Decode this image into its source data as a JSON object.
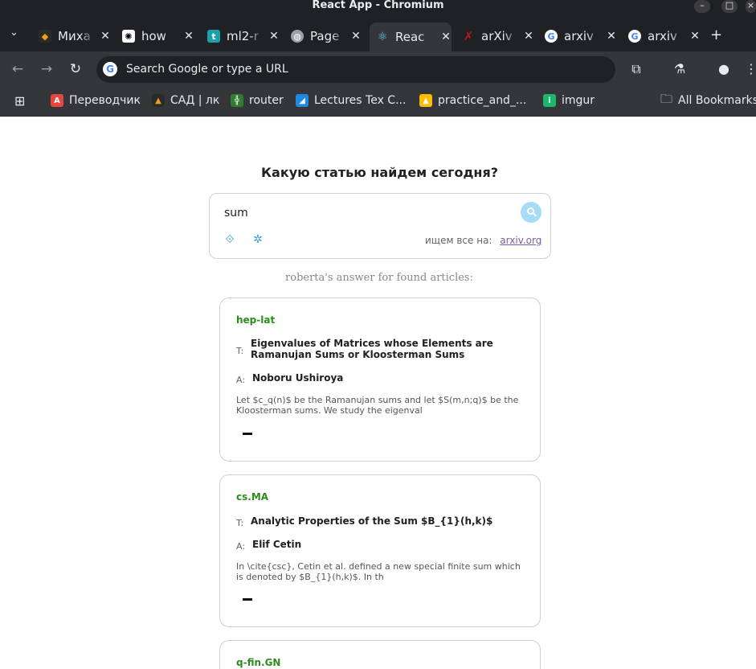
{
  "window": {
    "title": "React App - Chromium"
  },
  "tabs": [
    {
      "label": "Миха",
      "icon": "ya-music-icon",
      "color": "#e8a317",
      "active": false
    },
    {
      "label": "how",
      "icon": "chatgpt-icon",
      "color": "#000000",
      "active": false
    },
    {
      "label": "ml2-r",
      "icon": "t-icon",
      "color": "#1aa0a9",
      "active": false
    },
    {
      "label": "Page",
      "icon": "globe-icon",
      "color": "#9aa0a6",
      "active": false
    },
    {
      "label": "Reac",
      "icon": "react-icon",
      "color": "#61dafb",
      "active": true
    },
    {
      "label": "arXiv",
      "icon": "arxiv-icon",
      "color": "#b31b1b",
      "active": false
    },
    {
      "label": "arxiv",
      "icon": "google-icon",
      "color": "#4285f4",
      "active": false
    },
    {
      "label": "arxiv",
      "icon": "google-icon",
      "color": "#4285f4",
      "active": false
    }
  ],
  "omnibox": {
    "placeholder": "Search Google or type a URL"
  },
  "bookmarks": [
    {
      "label": "Переводчик",
      "color": "#e8453c"
    },
    {
      "label": "САД | лк",
      "color": "#e8a317"
    },
    {
      "label": "router",
      "color": "#2e7d32"
    },
    {
      "label": "Lectures Tex C...",
      "color": "#1e88e5"
    },
    {
      "label": "practice_and_...",
      "color": "#fbbc04"
    },
    {
      "label": "imgur",
      "color": "#1bb76e"
    }
  ],
  "all_bookmarks": "All Bookmarks",
  "page": {
    "heading": "Какую статью найдем сегодня?",
    "search": {
      "value": "sum"
    },
    "source_label": "ищем все на:",
    "source_link": "arxiv.org",
    "answer_caption": "roberta's answer for found articles:",
    "t_label": "T:",
    "a_label": "A:",
    "articles": [
      {
        "category": "hep-lat",
        "title": "Eigenvalues of Matrices whose Elements are Ramanujan Sums or Kloosterman Sums",
        "authors": "Noboru Ushiroya",
        "abstract": "Let $c_q(n)$ be the Ramanujan sums and let $S(m,n;q)$ be the Kloosterman sums. We study the eigenval"
      },
      {
        "category": "cs.MA",
        "title": "Analytic Properties of the Sum $B_{1}(h,k)$",
        "authors": "Elif Cetin",
        "abstract": "In \\cite{csc}, Cetin et al. defined a new special finite sum which is denoted by $B_{1}(h,k)$. In th"
      },
      {
        "category": "q-fin.GN",
        "title": "",
        "authors": "",
        "abstract": ""
      }
    ]
  }
}
